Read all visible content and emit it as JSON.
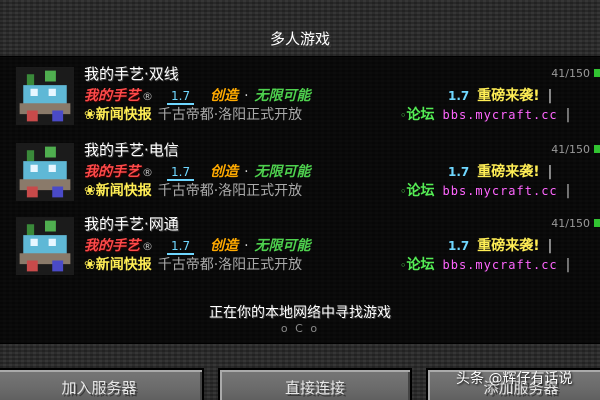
{
  "screen": {
    "title": "多人游戏"
  },
  "servers": [
    {
      "name": "我的手艺·双线",
      "players": "41/150",
      "motd": {
        "brand": "我的手艺",
        "reg": "®",
        "version": "1.7",
        "create": "创造",
        "dot": "·",
        "unlimited": "无限可能",
        "version2": "1.7",
        "heavy": "重磅来袭!",
        "bar": "|",
        "news_icon": "❀",
        "news": "新闻快报",
        "ancient": "千古帝都·洛阳正式开放",
        "forum_icon": "◦",
        "forum": "论坛",
        "url": "bbs.mycraft.cc",
        "sep": "|"
      }
    },
    {
      "name": "我的手艺·电信",
      "players": "41/150",
      "motd": {
        "brand": "我的手艺",
        "reg": "®",
        "version": "1.7",
        "create": "创造",
        "dot": "·",
        "unlimited": "无限可能",
        "version2": "1.7",
        "heavy": "重磅来袭!",
        "bar": "|",
        "news_icon": "❀",
        "news": "新闻快报",
        "ancient": "千古帝都·洛阳正式开放",
        "forum_icon": "◦",
        "forum": "论坛",
        "url": "bbs.mycraft.cc",
        "sep": "|"
      }
    },
    {
      "name": "我的手艺·网通",
      "players": "41/150",
      "motd": {
        "brand": "我的手艺",
        "reg": "®",
        "version": "1.7",
        "create": "创造",
        "dot": "·",
        "unlimited": "无限可能",
        "version2": "1.7",
        "heavy": "重磅来袭!",
        "bar": "|",
        "news_icon": "❀",
        "news": "新闻快报",
        "ancient": "千古帝都·洛阳正式开放",
        "forum_icon": "◦",
        "forum": "论坛",
        "url": "bbs.mycraft.cc",
        "sep": "|"
      }
    }
  ],
  "lan": {
    "message": "正在你的本地网络中寻找游戏",
    "spinner": "o C o"
  },
  "buttons": {
    "join": "加入服务器",
    "direct": "直接连接",
    "add": "添加服务器"
  },
  "watermark": "头条 @辉仔有话说",
  "colors": {
    "brand": "#ff4a4a",
    "create": "#ffaa00",
    "unlimited": "#4ed14e",
    "version": "#6fd7ff",
    "heavy": "#ffee55",
    "url": "#ff66ff",
    "signal": "#31c331"
  },
  "icons": {
    "server_icon": "pixel-castle-icon",
    "signal": "signal-strength-icon"
  }
}
